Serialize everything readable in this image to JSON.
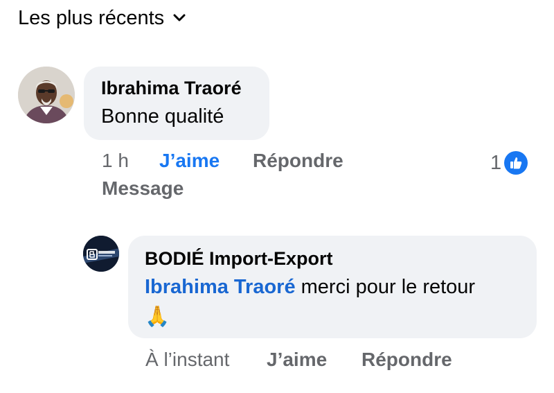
{
  "sort": {
    "label": "Les plus récents",
    "icon": "chevron-down-icon"
  },
  "comments": [
    {
      "author": "Ibrahima Traoré",
      "text": "Bonne qualité",
      "time": "1 h",
      "like_label": "J’aime",
      "reply_label": "Répondre",
      "message_label": "Message",
      "reaction_count": "1",
      "reaction_icon": "thumbs-up-icon",
      "avatar_icon": "profile-photo"
    }
  ],
  "reply": {
    "author": "BODIÉ Import-Export",
    "mention": "Ibrahima Traoré",
    "text": " merci pour le retour",
    "emoji": "🙏",
    "time": "À l’instant",
    "like_label": "J’aime",
    "reply_label": "Répondre",
    "avatar_icon": "page-logo"
  },
  "colors": {
    "link_blue": "#1967d2",
    "like_blue": "#1877f2",
    "bubble_bg": "#f0f2f5",
    "meta_gray": "#65676b"
  }
}
